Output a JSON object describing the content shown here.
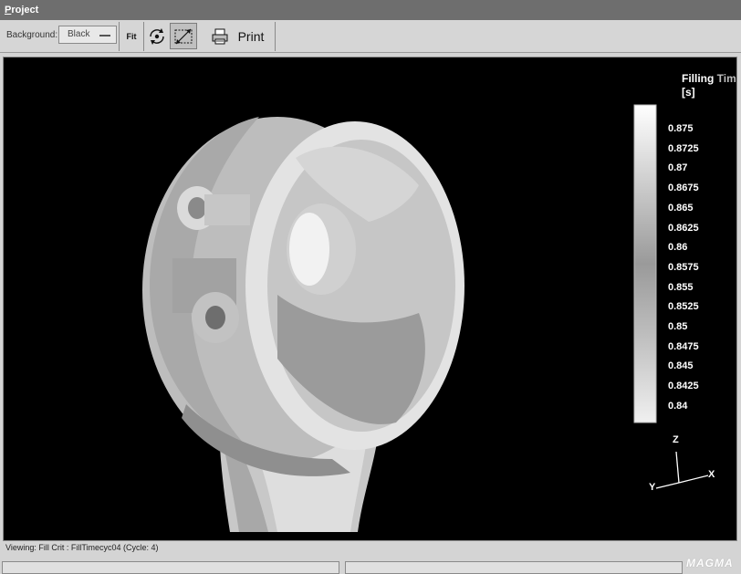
{
  "window": {
    "title_first": "P",
    "title_rest": "roject"
  },
  "toolbar": {
    "background_label": "Background:",
    "background_value": "Black",
    "fit_label": "Fit",
    "rotate_icon": "rotate-icon",
    "zoom_icon": "zoom-box-icon",
    "printer_icon": "printer-icon",
    "print_label": "Print"
  },
  "legend": {
    "title_main": "Filling ",
    "title_faded": "Tim",
    "unit": "[s]",
    "values": [
      "0.875",
      "0.8725",
      "0.87",
      "0.8675",
      "0.865",
      "0.8625",
      "0.86",
      "0.8575",
      "0.855",
      "0.8525",
      "0.85",
      "0.8475",
      "0.845",
      "0.8425",
      "0.84"
    ]
  },
  "axes": {
    "z": "Z",
    "x": "X",
    "y": "Y"
  },
  "status": {
    "text": "Viewing: Fill Crit : FillTimecyc04 (Cycle: 4)"
  },
  "logo": "MAGMA",
  "colors": {
    "viewport_bg": "#000000",
    "titlebar": "#6e6e6e"
  }
}
